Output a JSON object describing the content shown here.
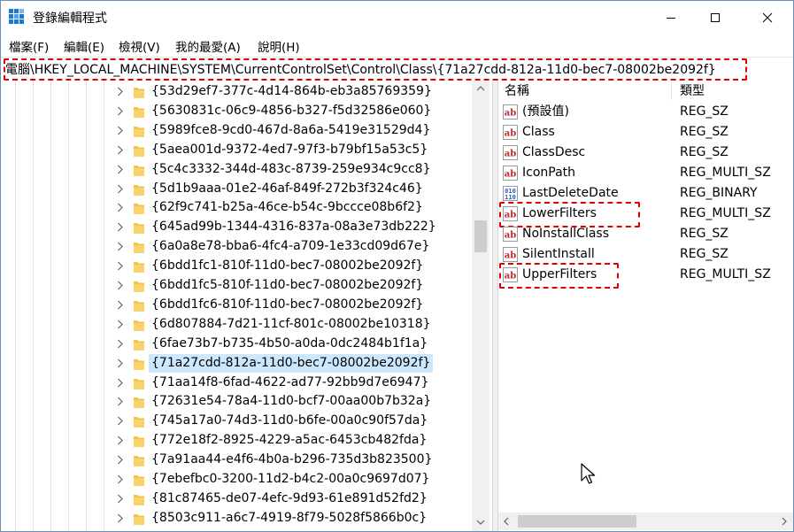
{
  "window": {
    "title": "登錄編輯程式",
    "icon": "regedit-icon",
    "buttons": [
      "minimize",
      "maximize",
      "close"
    ]
  },
  "menu": [
    "檔案(F)",
    "編輯(E)",
    "檢視(V)",
    "我的最愛(A)",
    "說明(H)"
  ],
  "address": {
    "path": "電腦\\HKEY_LOCAL_MACHINE\\SYSTEM\\CurrentControlSet\\Control\\Class\\{71a27cdd-812a-11d0-bec7-08002be2092f}",
    "highlight_color": "#e00000"
  },
  "tree": {
    "keys": [
      {
        "label": "{53d29ef7-377c-4d14-864b-eb3a85769359}"
      },
      {
        "label": "{5630831c-06c9-4856-b327-f5d32586e060}"
      },
      {
        "label": "{5989fce8-9cd0-467d-8a6a-5419e31529d4}"
      },
      {
        "label": "{5aea001d-9372-4ed7-97f3-b79bf15a53c5}"
      },
      {
        "label": "{5c4c3332-344d-483c-8739-259e934c9cc8}"
      },
      {
        "label": "{5d1b9aaa-01e2-46af-849f-272b3f324c46}"
      },
      {
        "label": "{62f9c741-b25a-46ce-b54c-9bccce08b6f2}"
      },
      {
        "label": "{645ad99b-1344-4316-837a-08a3e73db222}"
      },
      {
        "label": "{6a0a8e78-bba6-4fc4-a709-1e33cd09d67e}"
      },
      {
        "label": "{6bdd1fc1-810f-11d0-bec7-08002be2092f}"
      },
      {
        "label": "{6bdd1fc5-810f-11d0-bec7-08002be2092f}"
      },
      {
        "label": "{6bdd1fc6-810f-11d0-bec7-08002be2092f}"
      },
      {
        "label": "{6d807884-7d21-11cf-801c-08002be10318}"
      },
      {
        "label": "{6fae73b7-b735-4b50-a0da-0dc2484b1f1a}"
      },
      {
        "label": "{71a27cdd-812a-11d0-bec7-08002be2092f}",
        "selected": true
      },
      {
        "label": "{71aa14f8-6fad-4622-ad77-92bb9d7e6947}"
      },
      {
        "label": "{72631e54-78a4-11d0-bcf7-00aa00b7b32a}"
      },
      {
        "label": "{745a17a0-74d3-11d0-b6fe-00a0c90f57da}"
      },
      {
        "label": "{772e18f2-8925-4229-a5ac-6453cb482fda}"
      },
      {
        "label": "{7a91aa44-e4f6-4b0a-b296-735d3b823500}"
      },
      {
        "label": "{7ebefbc0-3200-11d2-b4c2-00a0c9697d07}"
      },
      {
        "label": "{81c87465-de07-4efc-9d93-61e891d52fd2}"
      },
      {
        "label": "{8503c911-a6c7-4919-8f79-5028f5866b0c}"
      }
    ],
    "selected_color": "#cce8ff",
    "folder_color": "#f4c142"
  },
  "list": {
    "headers": {
      "name": "名稱",
      "type": "類型"
    },
    "values": [
      {
        "name": "(預設值)",
        "type": "REG_SZ",
        "icon": "string-value-icon"
      },
      {
        "name": "Class",
        "type": "REG_SZ",
        "icon": "string-value-icon"
      },
      {
        "name": "ClassDesc",
        "type": "REG_SZ",
        "icon": "string-value-icon"
      },
      {
        "name": "IconPath",
        "type": "REG_MULTI_SZ",
        "icon": "string-value-icon"
      },
      {
        "name": "LastDeleteDate",
        "type": "REG_BINARY",
        "icon": "binary-value-icon"
      },
      {
        "name": "LowerFilters",
        "type": "REG_MULTI_SZ",
        "icon": "string-value-icon",
        "highlighted": true
      },
      {
        "name": "NoInstallClass",
        "type": "REG_SZ",
        "icon": "string-value-icon"
      },
      {
        "name": "SilentInstall",
        "type": "REG_SZ",
        "icon": "string-value-icon"
      },
      {
        "name": "UpperFilters",
        "type": "REG_MULTI_SZ",
        "icon": "string-value-icon",
        "highlighted": true
      }
    ]
  },
  "colors": {
    "annotation_red": "#e00000",
    "string_icon_red": "#c3262e",
    "binary_icon_blue": "#2b5fb6"
  }
}
